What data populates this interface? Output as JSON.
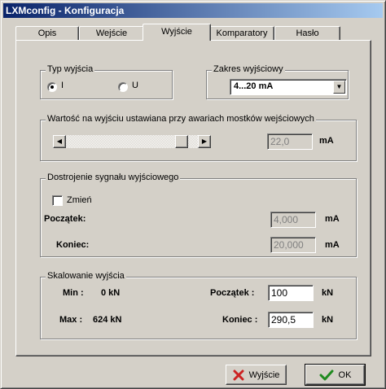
{
  "window": {
    "title": "LXMconfig - Konfiguracja"
  },
  "tabs": [
    "Opis",
    "Wejście",
    "Wyjście",
    "Komparatory",
    "Hasło"
  ],
  "active_tab": "Wyjście",
  "output_type": {
    "legend": "Typ wyjścia",
    "options": [
      "I",
      "U"
    ],
    "selected": "I"
  },
  "output_range": {
    "legend": "Zakres wyjściowy",
    "selected": "4...20 mA"
  },
  "fault_value": {
    "legend": "Wartość na wyjściu ustawiana przy awariach mostków wejściowych",
    "value": "22,0",
    "unit": "mA",
    "slider_fraction": 0.92
  },
  "tuning": {
    "legend": "Dostrojenie sygnału wyjściowego",
    "change_label": "Zmień",
    "change_checked": false,
    "start_label": "Początek:",
    "start_value": "4,000",
    "start_unit": "mA",
    "end_label": "Koniec:",
    "end_value": "20,000",
    "end_unit": "mA"
  },
  "scaling": {
    "legend": "Skalowanie wyjścia",
    "min_label": "Min :",
    "min_value": "0 kN",
    "max_label": "Max :",
    "max_value": "624 kN",
    "start_label": "Początek :",
    "start_value": "100",
    "start_unit": "kN",
    "end_label": "Koniec :",
    "end_value": "290,5",
    "end_unit": "kN"
  },
  "buttons": {
    "exit": "Wyjście",
    "ok": "OK"
  },
  "colors": {
    "title_start": "#0a246a",
    "title_end": "#a6caf0",
    "exit_icon": "#cc2222",
    "ok_icon": "#1f8a1f"
  },
  "icons": {
    "exit": "red-x-icon",
    "ok": "green-check-icon"
  }
}
